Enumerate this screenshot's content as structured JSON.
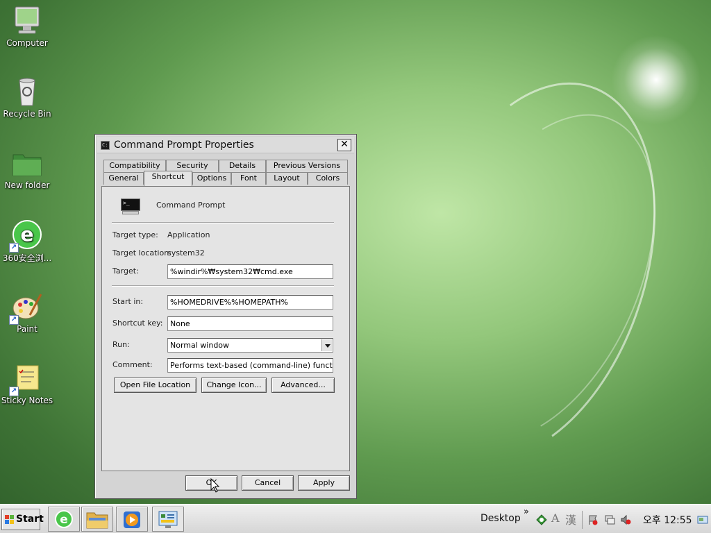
{
  "desktop": {
    "icons": [
      {
        "label": "Computer"
      },
      {
        "label": "Recycle Bin"
      },
      {
        "label": "New folder"
      },
      {
        "label": "360安全浏..."
      },
      {
        "label": "Paint"
      },
      {
        "label": "Sticky Notes"
      }
    ]
  },
  "dialog": {
    "title": "Command Prompt Properties",
    "close_glyph": "✕",
    "tabs_top": [
      "Compatibility",
      "Security",
      "Details",
      "Previous Versions"
    ],
    "tabs_bottom": [
      "General",
      "Shortcut",
      "Options",
      "Font",
      "Layout",
      "Colors"
    ],
    "active_tab": "Shortcut",
    "shortcut": {
      "name": "Command Prompt",
      "target_type_label": "Target type:",
      "target_type_value": "Application",
      "target_location_label": "Target location:",
      "target_location_value": "system32",
      "target_label": "Target:",
      "target_value": "%windir%₩system32₩cmd.exe",
      "start_in_label": "Start in:",
      "start_in_value": "%HOMEDRIVE%%HOMEPATH%",
      "shortcut_key_label": "Shortcut key:",
      "shortcut_key_value": "None",
      "run_label": "Run:",
      "run_value": "Normal window",
      "comment_label": "Comment:",
      "comment_value": "Performs text-based (command-line) functions.",
      "open_file_location": "Open File Location",
      "change_icon": "Change Icon...",
      "advanced": "Advanced..."
    },
    "ok": "OK",
    "cancel": "Cancel",
    "apply": "Apply"
  },
  "taskbar": {
    "start_label": "Start",
    "toolbar_label": "Desktop",
    "chevron": "»",
    "ime_a": "A",
    "ime_han": "漢",
    "clock": "오후 12:55"
  },
  "colors": {
    "desktop_green": "#5f9a4f",
    "dialog_gray": "#d4d4d4"
  }
}
